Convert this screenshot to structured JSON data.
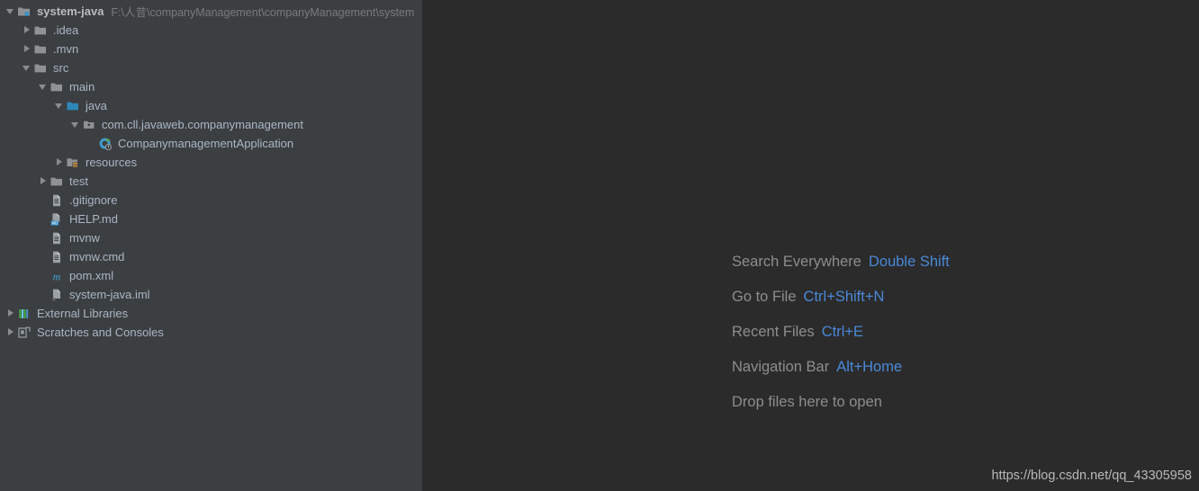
{
  "project_tree": {
    "root": {
      "label": "system-java",
      "path": "F:\\人昔\\companyManagement\\companyManagement\\system",
      "icon": "module-folder-icon",
      "expanded": true,
      "indent": 0
    },
    "items": [
      {
        "label": ".idea",
        "icon": "folder-icon",
        "arrow": "closed",
        "indent": 1
      },
      {
        "label": ".mvn",
        "icon": "folder-icon",
        "arrow": "closed",
        "indent": 1
      },
      {
        "label": "src",
        "icon": "folder-icon",
        "arrow": "open",
        "indent": 1
      },
      {
        "label": "main",
        "icon": "folder-icon",
        "arrow": "open",
        "indent": 2
      },
      {
        "label": "java",
        "icon": "source-folder-icon",
        "arrow": "open",
        "indent": 3
      },
      {
        "label": "com.cll.javaweb.companymanagement",
        "icon": "package-icon",
        "arrow": "open",
        "indent": 4
      },
      {
        "label": "CompanymanagementApplication",
        "icon": "spring-application-icon",
        "arrow": "none",
        "indent": 5
      },
      {
        "label": "resources",
        "icon": "resources-folder-icon",
        "arrow": "closed",
        "indent": 3
      },
      {
        "label": "test",
        "icon": "folder-icon",
        "arrow": "closed",
        "indent": 2
      },
      {
        "label": ".gitignore",
        "icon": "file-icon",
        "arrow": "none",
        "indent": 2
      },
      {
        "label": "HELP.md",
        "icon": "markdown-file-icon",
        "arrow": "none",
        "indent": 2
      },
      {
        "label": "mvnw",
        "icon": "file-icon",
        "arrow": "none",
        "indent": 2
      },
      {
        "label": "mvnw.cmd",
        "icon": "file-icon",
        "arrow": "none",
        "indent": 2
      },
      {
        "label": "pom.xml",
        "icon": "maven-file-icon",
        "arrow": "none",
        "indent": 2
      },
      {
        "label": "system-java.iml",
        "icon": "iml-file-icon",
        "arrow": "none",
        "indent": 2
      },
      {
        "label": "External Libraries",
        "icon": "libraries-icon",
        "arrow": "closed",
        "indent": 0
      },
      {
        "label": "Scratches and Consoles",
        "icon": "scratches-icon",
        "arrow": "closed",
        "indent": 0
      }
    ]
  },
  "editor": {
    "hints": [
      {
        "action": "Search Everywhere",
        "shortcut": "Double Shift"
      },
      {
        "action": "Go to File",
        "shortcut": "Ctrl+Shift+N"
      },
      {
        "action": "Recent Files",
        "shortcut": "Ctrl+E"
      },
      {
        "action": "Navigation Bar",
        "shortcut": "Alt+Home"
      },
      {
        "action": "Drop files here to open",
        "shortcut": ""
      }
    ],
    "watermark": "https://blog.csdn.net/qq_43305958"
  },
  "colors": {
    "sidebar_bg": "#3c3f41",
    "editor_bg": "#2b2b2b",
    "text": "#a9b7c6",
    "hint_text": "#8d8d8d",
    "shortcut_blue": "#4a88d8",
    "path_gray": "#7a7a7a"
  }
}
